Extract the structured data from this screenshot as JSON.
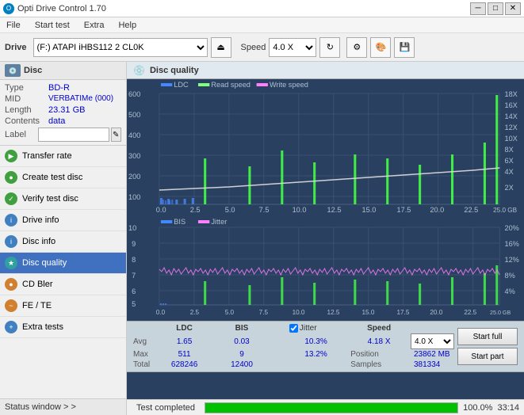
{
  "titlebar": {
    "title": "Opti Drive Control 1.70",
    "min_label": "─",
    "max_label": "□",
    "close_label": "✕"
  },
  "menubar": {
    "items": [
      "File",
      "Start test",
      "Extra",
      "Help"
    ]
  },
  "toolbar": {
    "drive_label": "Drive",
    "drive_value": "(F:)  ATAPI iHBS112  2 CL0K",
    "speed_label": "Speed",
    "speed_value": "4.0 X"
  },
  "disc": {
    "header": "Disc",
    "type_label": "Type",
    "type_value": "BD-R",
    "mid_label": "MID",
    "mid_value": "VERBATIMe (000)",
    "length_label": "Length",
    "length_value": "23.31 GB",
    "contents_label": "Contents",
    "contents_value": "data",
    "label_label": "Label",
    "label_placeholder": ""
  },
  "nav": {
    "items": [
      {
        "id": "transfer-rate",
        "label": "Transfer rate",
        "icon": "▶",
        "icon_class": "icon-green"
      },
      {
        "id": "create-test-disc",
        "label": "Create test disc",
        "icon": "●",
        "icon_class": "icon-green"
      },
      {
        "id": "verify-test-disc",
        "label": "Verify test disc",
        "icon": "✓",
        "icon_class": "icon-green"
      },
      {
        "id": "drive-info",
        "label": "Drive info",
        "icon": "i",
        "icon_class": "icon-blue"
      },
      {
        "id": "disc-info",
        "label": "Disc info",
        "icon": "i",
        "icon_class": "icon-blue"
      },
      {
        "id": "disc-quality",
        "label": "Disc quality",
        "icon": "★",
        "icon_class": "icon-teal",
        "active": true
      },
      {
        "id": "cd-bler",
        "label": "CD Bler",
        "icon": "●",
        "icon_class": "icon-orange"
      },
      {
        "id": "fe-te",
        "label": "FE / TE",
        "icon": "~",
        "icon_class": "icon-orange"
      },
      {
        "id": "extra-tests",
        "label": "Extra tests",
        "icon": "+",
        "icon_class": "icon-blue"
      }
    ],
    "status_window": "Status window > >"
  },
  "disc_quality": {
    "title": "Disc quality",
    "legend_top": [
      "LDC",
      "Read speed",
      "Write speed"
    ],
    "legend_bottom": [
      "BIS",
      "Jitter"
    ],
    "top_y_left_max": "600",
    "top_y_right_labels": [
      "18X",
      "16X",
      "14X",
      "12X",
      "10X",
      "8X",
      "6X",
      "4X",
      "2X"
    ],
    "bottom_y_right_labels": [
      "20%",
      "16%",
      "12%",
      "8%",
      "4%"
    ],
    "x_labels": [
      "0.0",
      "2.5",
      "5.0",
      "7.5",
      "10.0",
      "12.5",
      "15.0",
      "17.5",
      "20.0",
      "22.5",
      "25.0 GB"
    ],
    "stats": {
      "headers": [
        "LDC",
        "BIS",
        "",
        "Jitter",
        "Speed",
        ""
      ],
      "avg_label": "Avg",
      "avg_ldc": "1.65",
      "avg_bis": "0.03",
      "avg_jitter": "10.3%",
      "avg_speed": "4.18 X",
      "avg_speed_select": "4.0 X",
      "max_label": "Max",
      "max_ldc": "511",
      "max_bis": "9",
      "max_jitter": "13.2%",
      "max_pos_label": "Position",
      "max_pos_value": "23862 MB",
      "total_label": "Total",
      "total_ldc": "628246",
      "total_bis": "12400",
      "total_samples_label": "Samples",
      "total_samples_value": "381334",
      "jitter_checked": true,
      "jitter_label": "Jitter"
    },
    "buttons": {
      "start_full": "Start full",
      "start_part": "Start part"
    }
  },
  "progress": {
    "status": "Test completed",
    "percent": "100.0%",
    "time": "33:14"
  }
}
